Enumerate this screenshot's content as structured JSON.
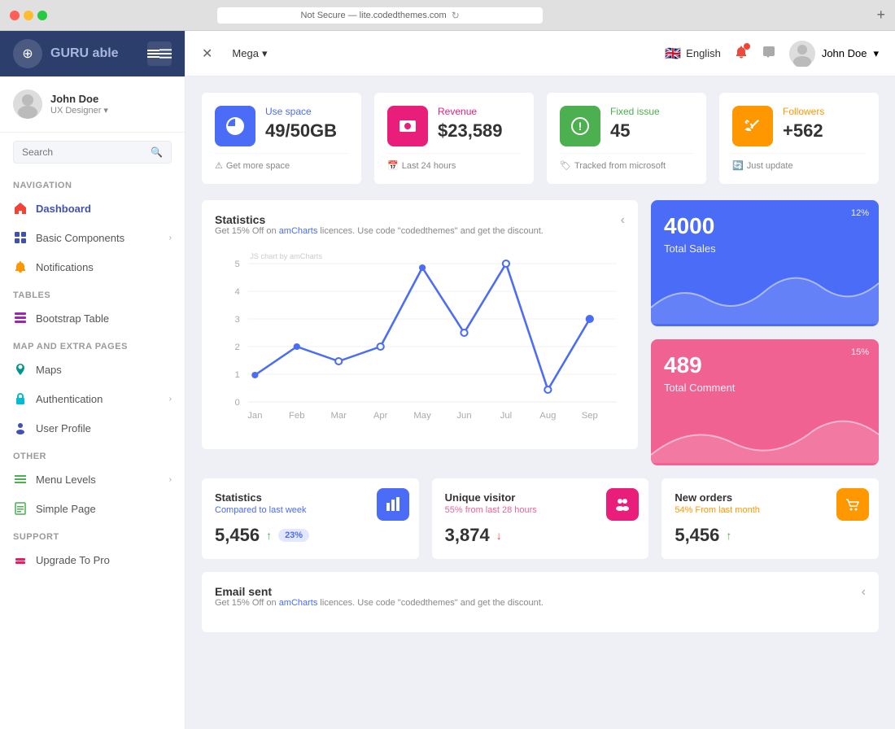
{
  "browser": {
    "url": "Not Secure — lite.codedthemes.com"
  },
  "sidebar": {
    "logo_text": "GURU",
    "logo_subtext": " able",
    "user": {
      "name": "John Doe",
      "role": "UX Designer"
    },
    "search_placeholder": "Search",
    "sections": [
      {
        "title": "Navigation",
        "items": [
          {
            "label": "Dashboard",
            "icon": "🏠",
            "color": "red",
            "active": true
          },
          {
            "label": "Basic Components",
            "icon": "⚡",
            "color": "blue",
            "has_arrow": true
          },
          {
            "label": "Notifications",
            "icon": "🔔",
            "color": "orange"
          }
        ]
      },
      {
        "title": "Tables",
        "items": [
          {
            "label": "Bootstrap Table",
            "icon": "📋",
            "color": "purple"
          }
        ]
      },
      {
        "title": "Map And Extra Pages",
        "items": [
          {
            "label": "Maps",
            "icon": "🗺",
            "color": "teal"
          },
          {
            "label": "Authentication",
            "icon": "🔐",
            "color": "cyan",
            "has_arrow": true
          },
          {
            "label": "User Profile",
            "icon": "👤",
            "color": "blue"
          }
        ]
      },
      {
        "title": "Other",
        "items": [
          {
            "label": "Menu Levels",
            "icon": "☰",
            "color": "green",
            "has_arrow": true
          },
          {
            "label": "Simple Page",
            "icon": "📄",
            "color": "green"
          }
        ]
      },
      {
        "title": "Support",
        "items": [
          {
            "label": "Upgrade To Pro",
            "icon": "⬆",
            "color": "pink"
          }
        ]
      }
    ]
  },
  "topbar": {
    "collapse_icon": "✕",
    "nav_item": "Mega",
    "language": "English",
    "user_name": "John Doe"
  },
  "stat_cards": [
    {
      "label": "Use space",
      "value": "49/50GB",
      "footer": "Get more space",
      "icon": "🥧",
      "icon_class": "stat-icon-blue",
      "label_class": "stat-label-blue"
    },
    {
      "label": "Revenue",
      "value": "$23,589",
      "footer": "Last 24 hours",
      "icon": "🏠",
      "icon_class": "stat-icon-pink",
      "label_class": "stat-label-pink"
    },
    {
      "label": "Fixed issue",
      "value": "45",
      "footer": "Tracked from microsoft",
      "icon": "❗",
      "icon_class": "stat-icon-green",
      "label_class": "stat-label-green"
    },
    {
      "label": "Followers",
      "value": "+562",
      "footer": "Just update",
      "icon": "🐦",
      "icon_class": "stat-icon-orange",
      "label_class": "stat-label-orange"
    }
  ],
  "statistics_chart": {
    "title": "Statistics",
    "subtitle": "Get 15% Off on amCharts licences. Use code \"codedthemes\" and get the discount.",
    "x_labels": [
      "Jan",
      "Feb",
      "Mar",
      "Apr",
      "May",
      "Jun",
      "Jul",
      "Aug",
      "Sep"
    ],
    "y_labels": [
      "5",
      "4",
      "3",
      "2",
      "1",
      "0"
    ],
    "annotation": "JS chart by amCharts"
  },
  "panels": [
    {
      "value": "4000",
      "label": "Total Sales",
      "percent": "12%",
      "class": "panel-card-blue"
    },
    {
      "value": "489",
      "label": "Total Comment",
      "percent": "15%",
      "class": "panel-card-red"
    }
  ],
  "mini_cards": [
    {
      "title": "Statistics",
      "subtitle": "Compared to last week",
      "value": "5,456",
      "trend": "up",
      "badge": "23%",
      "icon": "🖥",
      "icon_class": "mini-icon-blue",
      "subtitle_class": "mini-subtitle-blue"
    },
    {
      "title": "Unique visitor",
      "subtitle": "55% from last 28 hours",
      "value": "3,874",
      "trend": "down",
      "badge": "",
      "icon": "👥",
      "icon_class": "mini-icon-pink",
      "subtitle_class": "mini-subtitle-pink"
    },
    {
      "title": "New orders",
      "subtitle": "54% From last month",
      "value": "5,456",
      "trend": "up",
      "badge": "",
      "icon": "📊",
      "icon_class": "mini-icon-orange",
      "subtitle_class": "mini-subtitle-orange"
    }
  ],
  "email_section": {
    "title": "Email sent",
    "subtitle": "Get 15% Off on amCharts licences. Use code \"codedthemes\" and get the discount."
  }
}
